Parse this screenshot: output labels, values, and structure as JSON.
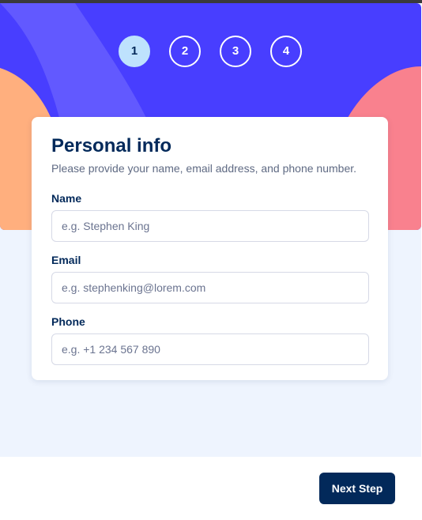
{
  "steps": [
    {
      "number": "1",
      "active": true
    },
    {
      "number": "2",
      "active": false
    },
    {
      "number": "3",
      "active": false
    },
    {
      "number": "4",
      "active": false
    }
  ],
  "form": {
    "title": "Personal info",
    "subtitle": "Please provide your name, email address, and phone number.",
    "name_label": "Name",
    "name_placeholder": "e.g. Stephen King",
    "name_value": "",
    "email_label": "Email",
    "email_placeholder": "e.g. stephenking@lorem.com",
    "email_value": "",
    "phone_label": "Phone",
    "phone_placeholder": "e.g. +1 234 567 890",
    "phone_value": ""
  },
  "footer": {
    "next_label": "Next Step"
  },
  "colors": {
    "hero_bg": "#483eff",
    "hero_band": "#6259ff",
    "orange_blob": "#ffaf7e",
    "pink_blob": "#f9818e",
    "page_bg": "#eef4fe",
    "primary_text": "#02295a",
    "active_step_bg": "#bee2fd"
  }
}
